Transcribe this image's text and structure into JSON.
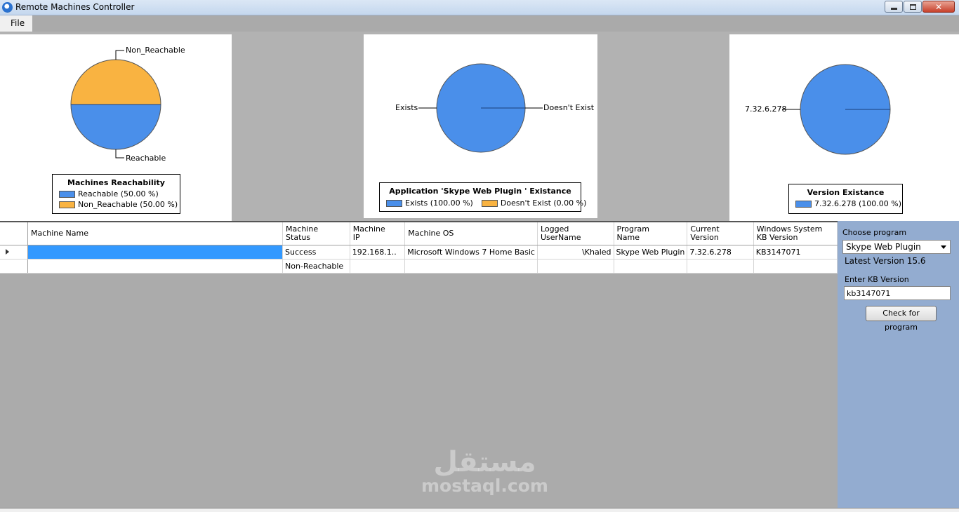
{
  "window": {
    "title": "Remote Machines Controller"
  },
  "menu": {
    "file": "File"
  },
  "charts": {
    "reachability": {
      "label_top": "Non_Reachable",
      "label_bottom": "Reachable",
      "legend_title": "Machines Reachability",
      "legend_items": [
        "Reachable (50.00 %)",
        "Non_Reachable (50.00 %)"
      ]
    },
    "existance": {
      "label_left": "Exists",
      "label_right": "Doesn't Exist",
      "legend_title": "Application 'Skype Web Plugin ' Existance",
      "legend_items": [
        "Exists (100.00 %)",
        "Doesn't Exist (0.00 %)"
      ]
    },
    "version": {
      "label_left": "7.32.6.278",
      "legend_title": "Version Existance",
      "legend_items": [
        "7.32.6.278 (100.00 %)"
      ]
    }
  },
  "chart_data": [
    {
      "type": "pie",
      "title": "Machines Reachability",
      "categories": [
        "Reachable",
        "Non_Reachable"
      ],
      "values": [
        50,
        50
      ],
      "colors": [
        "#4a8fea",
        "#f9b341"
      ]
    },
    {
      "type": "pie",
      "title": "Application 'Skype Web Plugin ' Existance",
      "categories": [
        "Exists",
        "Doesn't Exist"
      ],
      "values": [
        100,
        0
      ],
      "colors": [
        "#4a8fea",
        "#f9b341"
      ]
    },
    {
      "type": "pie",
      "title": "Version Existance",
      "categories": [
        "7.32.6.278"
      ],
      "values": [
        100
      ],
      "colors": [
        "#4a8fea"
      ]
    }
  ],
  "grid": {
    "headers": {
      "machine_name": "Machine Name",
      "status_1": "Machine",
      "status_2": "Status",
      "ip_1": "Machine",
      "ip_2": "IP",
      "os": "Machine OS",
      "user_1": "Logged",
      "user_2": "UserName",
      "program_1": "Program",
      "program_2": "Name",
      "version_1": "Current",
      "version_2": "Version",
      "kb_1": "Windows System",
      "kb_2": "KB Version"
    },
    "rows": [
      {
        "name": "",
        "status": "Success",
        "ip": "192.168.1..",
        "os": "Microsoft Windows 7 Home Basic",
        "user": "\\Khaled",
        "program": "Skype Web Plugin",
        "version": "7.32.6.278",
        "kb": "KB3147071"
      },
      {
        "name": "",
        "status": "Non-Reachable",
        "ip": "",
        "os": "",
        "user": "",
        "program": "",
        "version": "",
        "kb": ""
      }
    ]
  },
  "side": {
    "choose_label": "Choose program",
    "selected_program": "Skype Web Plugin",
    "latest_version": "Latest Version 15.6",
    "kb_label": "Enter KB Version",
    "kb_value": "kb3147071",
    "check_button": "Check for program"
  },
  "watermark": {
    "arabic": "مستقل",
    "latin": "mostaql.com"
  },
  "colors": {
    "pie_blue": "#4a8fea",
    "pie_orange": "#f9b341",
    "selection": "#3399ff",
    "side_panel": "#93acd0"
  }
}
